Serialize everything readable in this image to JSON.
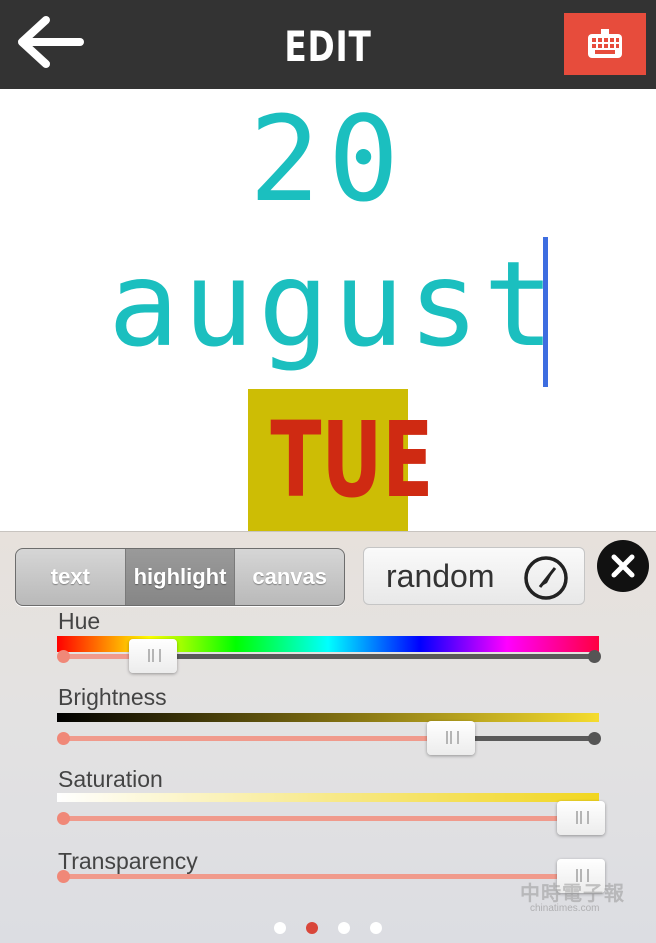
{
  "header": {
    "title": "EDIT",
    "back_icon": "arrow-left-icon",
    "keyboard_icon": "keyboard-icon",
    "keyboard_color": "#e74c3c"
  },
  "canvas": {
    "day": "20",
    "month": "august",
    "weekday": "TUE",
    "text_color": "#1bbfbf",
    "highlight_color": "#cdbd05",
    "weekday_color": "#cf2a12"
  },
  "panel": {
    "tabs": [
      {
        "label": "text",
        "active": false
      },
      {
        "label": "highlight",
        "active": true
      },
      {
        "label": "canvas",
        "active": false
      }
    ],
    "random_label": "random",
    "random_icon": "compass-icon",
    "close_icon": "close-icon",
    "sliders": [
      {
        "label": "Hue",
        "value": 0.17
      },
      {
        "label": "Brightness",
        "value": 0.73
      },
      {
        "label": "Saturation",
        "value": 1.0
      },
      {
        "label": "Transparency",
        "value": 1.0
      }
    ],
    "watermark": {
      "main": "中時電子報",
      "sub": "chinatimes.com"
    },
    "pager": {
      "pages": 4,
      "active": 1
    }
  }
}
